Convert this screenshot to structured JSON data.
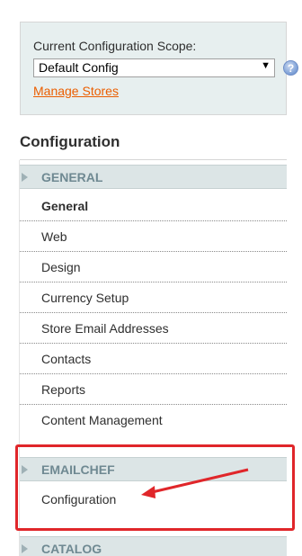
{
  "scope": {
    "label": "Current Configuration Scope:",
    "selected": "Default Config",
    "manage_link": "Manage Stores",
    "help_icon": "help-icon"
  },
  "config_title": "Configuration",
  "sections": {
    "general": {
      "header": "GENERAL",
      "items": [
        {
          "label": "General",
          "active": true
        },
        {
          "label": "Web"
        },
        {
          "label": "Design"
        },
        {
          "label": "Currency Setup"
        },
        {
          "label": "Store Email Addresses"
        },
        {
          "label": "Contacts"
        },
        {
          "label": "Reports"
        },
        {
          "label": "Content Management"
        }
      ]
    },
    "emailchef": {
      "header": "EMAILCHEF",
      "items": [
        {
          "label": "Configuration"
        }
      ]
    },
    "catalog": {
      "header": "CATALOG"
    }
  },
  "colors": {
    "link": "#eb5e00",
    "section_header_bg": "#dce5e6",
    "section_header_text": "#6f8992",
    "annotation": "#e0262a"
  }
}
